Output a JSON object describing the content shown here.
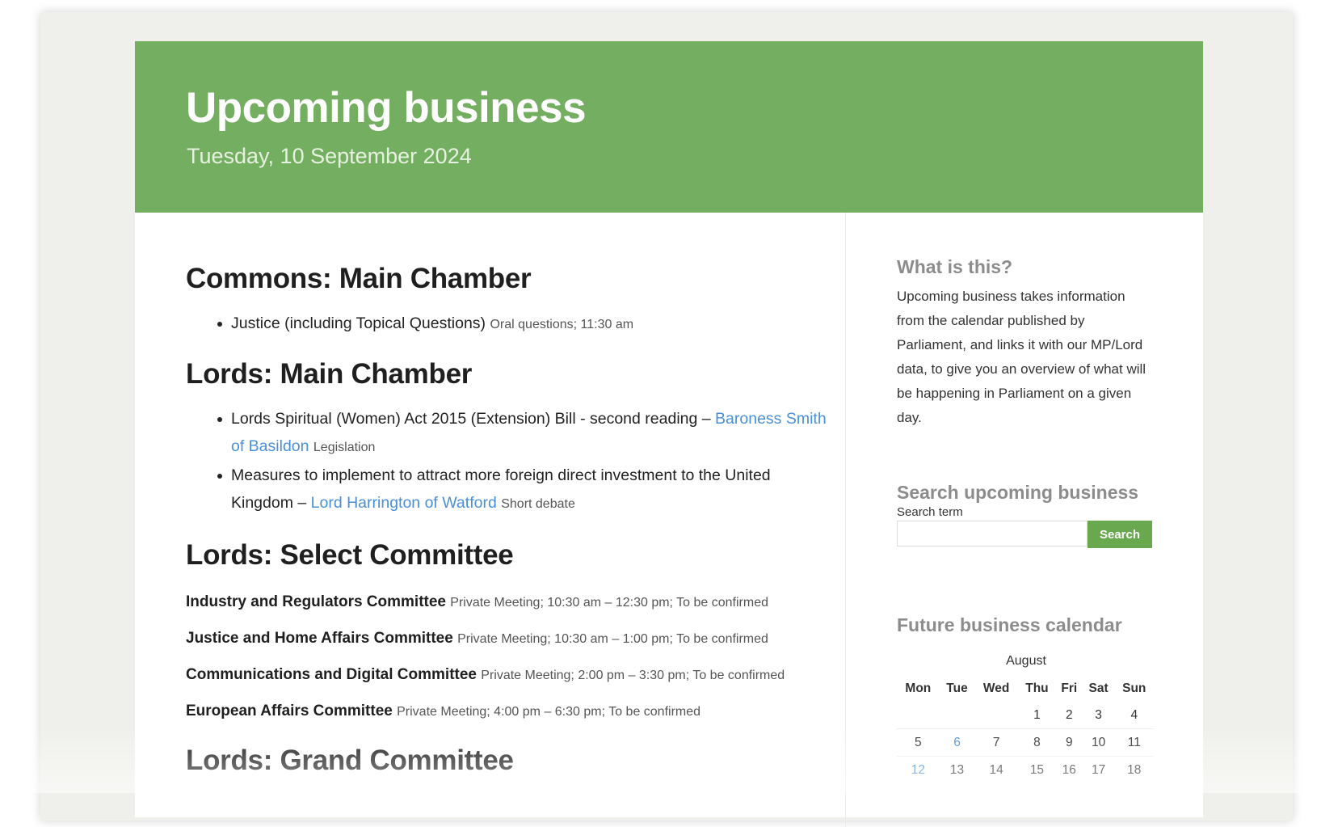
{
  "header": {
    "title": "Upcoming business",
    "date": "Tuesday, 10 September 2024"
  },
  "main": {
    "commons_main": {
      "title": "Commons: Main Chamber",
      "items": [
        {
          "text": "Justice (including Topical Questions)",
          "meta": "Oral questions; 11:30 am"
        }
      ]
    },
    "lords_main": {
      "title": "Lords: Main Chamber",
      "items": [
        {
          "text": "Lords Spiritual (Women) Act 2015 (Extension) Bill - second reading –",
          "link": "Baroness Smith of Basildon",
          "meta": "Legislation"
        },
        {
          "text": "Measures to implement to attract more foreign direct investment to the United Kingdom –",
          "link": "Lord Harrington of Watford",
          "meta": "Short debate"
        }
      ]
    },
    "lords_select": {
      "title": "Lords: Select Committee",
      "items": [
        {
          "name": "Industry and Regulators Committee",
          "meta": "Private Meeting; 10:30 am – 12:30 pm; To be confirmed"
        },
        {
          "name": "Justice and Home Affairs Committee",
          "meta": "Private Meeting; 10:30 am – 1:00 pm; To be confirmed"
        },
        {
          "name": "Communications and Digital Committee",
          "meta": "Private Meeting; 2:00 pm – 3:30 pm; To be confirmed"
        },
        {
          "name": "European Affairs Committee",
          "meta": "Private Meeting; 4:00 pm – 6:30 pm; To be confirmed"
        }
      ]
    },
    "lords_grand": {
      "title": "Lords: Grand Committee"
    }
  },
  "sidebar": {
    "about": {
      "heading": "What is this?",
      "text": "Upcoming business takes information from the calendar published by Parliament, and links it with our MP/Lord data, to give you an overview of what will be happening in Parliament on a given day."
    },
    "search": {
      "heading": "Search upcoming business",
      "label": "Search term",
      "placeholder": "",
      "value": "",
      "button": "Search"
    },
    "calendar": {
      "heading": "Future business calendar",
      "month": "August",
      "weekdays": [
        "Mon",
        "Tue",
        "Wed",
        "Thu",
        "Fri",
        "Sat",
        "Sun"
      ],
      "weeks": [
        [
          "",
          "",
          "",
          "1",
          "2",
          "3",
          "4"
        ],
        [
          "5",
          "6",
          "7",
          "8",
          "9",
          "10",
          "11"
        ],
        [
          "12",
          "13",
          "14",
          "15",
          "16",
          "17",
          "18"
        ]
      ],
      "linked_days": [
        "6",
        "12"
      ]
    }
  },
  "colors": {
    "header_bg": "#74ae60",
    "link": "#4a90d9",
    "search_button": "#6aa84f"
  }
}
